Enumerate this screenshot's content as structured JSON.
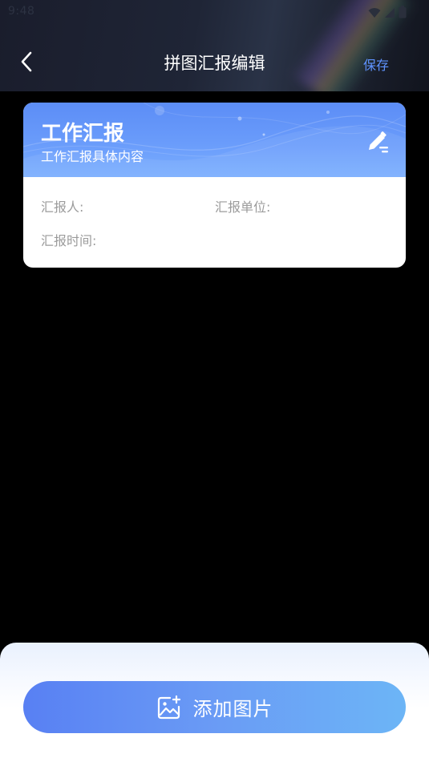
{
  "status_bar": {
    "time": "9:48",
    "icons": [
      "wifi-icon",
      "signal-icon",
      "battery-icon"
    ]
  },
  "nav": {
    "title": "拼图汇报编辑",
    "save_label": "保存",
    "back_icon": "chevron-left-icon"
  },
  "report_card": {
    "title": "工作汇报",
    "subtitle": "工作汇报具体内容",
    "edit_icon": "edit-pen-icon",
    "fields": {
      "reporter_label": "汇报人:",
      "unit_label": "汇报单位:",
      "time_label": "汇报时间:"
    }
  },
  "bottom": {
    "add_label": "添加图片",
    "add_icon": "add-image-icon"
  },
  "colors": {
    "accent": "#5f93ff",
    "card_header": "#6a9cfb",
    "button_start": "#5880f3",
    "button_end": "#6cb5f6",
    "field_label": "#9b9b9b"
  }
}
